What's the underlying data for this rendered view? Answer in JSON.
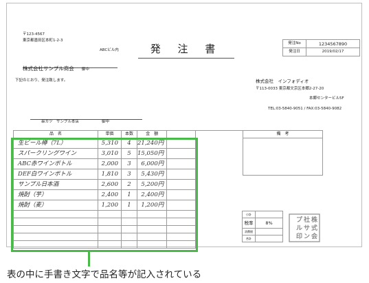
{
  "recipient": {
    "postal": "〒123-4567",
    "address": "東京都墨田区本町1-2-3",
    "building": "ABCビル内",
    "company": "株式会社サンプル商会",
    "honorific": "御中"
  },
  "title": "発 注 書",
  "meta": {
    "order_no_label": "発注No",
    "order_no": "1234567890",
    "date_label": "発注日",
    "date": "2019/02/17"
  },
  "intro": "下記のとおり、発注致します。",
  "sender": {
    "company": "株式会社　インフォディオ",
    "address": "〒113-0033 東京都文京区本郷2-27-20",
    "building": "本郷センタービル5F",
    "contact": "TEL:03-5840-9051 / FAX:03-5840-9082"
  },
  "delivery": {
    "name": "串カツ　サンプル本店",
    "honorific": "御中"
  },
  "table": {
    "headers": [
      "品　名",
      "単価",
      "本数",
      "金　額"
    ],
    "remarks_header": "備　考",
    "rows": [
      {
        "name": "生ビール樽（7L）",
        "price": "5,310",
        "qty": "4",
        "amount": "21,240円"
      },
      {
        "name": "スパークリングワイン",
        "price": "3,010",
        "qty": "5",
        "amount": "15,050円"
      },
      {
        "name": "ABC赤ワインボトル",
        "price": "2,000",
        "qty": "3",
        "amount": "6,000円"
      },
      {
        "name": "DEF白ワインボトル",
        "price": "1,810",
        "qty": "3",
        "amount": "5,430円"
      },
      {
        "name": "サンプル日本酒",
        "price": "2,600",
        "qty": "2",
        "amount": "5,200円"
      },
      {
        "name": "焼酎（芋）",
        "price": "2,400",
        "qty": "1",
        "amount": "2,400円"
      },
      {
        "name": "焼酎（麦）",
        "price": "1,200",
        "qty": "1",
        "amount": "1,200円"
      }
    ]
  },
  "totals": {
    "subtotal_label": "小計",
    "tax_rate_label": "税率",
    "tax_rate": "8%",
    "tax_label": "消費税",
    "total_label": "合計"
  },
  "stamp": {
    "text": "株式会社サンプル印"
  },
  "caption": "表の中に手書き文字で品名等が記入されている",
  "colors": {
    "highlight": "#49b949",
    "rule": "#9a9a9a"
  }
}
